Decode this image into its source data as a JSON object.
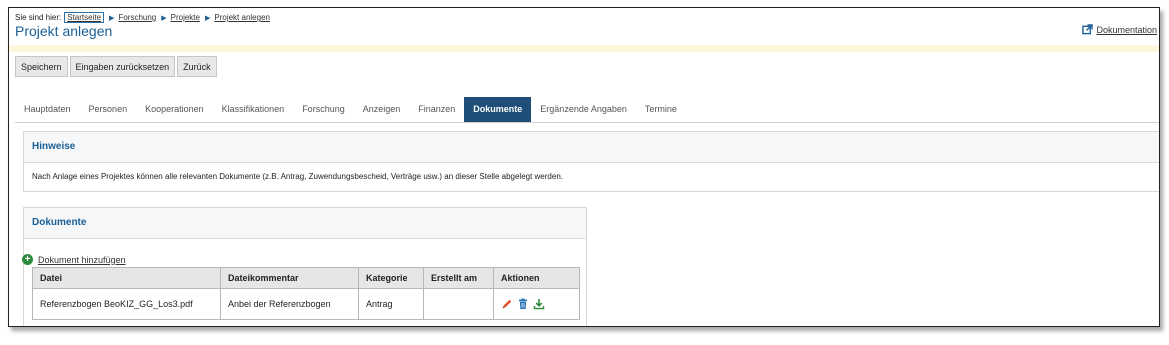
{
  "breadcrumb": {
    "prefix": "Sie sind hier:",
    "items": [
      "Startseite",
      "Forschung",
      "Projekte",
      "Projekt anlegen"
    ]
  },
  "page_title": "Projekt anlegen",
  "documentation_link": "Dokumentation",
  "buttons": {
    "save": "Speichern",
    "reset": "Eingaben zurücksetzen",
    "back": "Zurück"
  },
  "tabs": [
    "Hauptdaten",
    "Personen",
    "Kooperationen",
    "Klassifikationen",
    "Forschung",
    "Anzeigen",
    "Finanzen",
    "Dokumente",
    "Ergänzende Angaben",
    "Termine"
  ],
  "active_tab": "Dokumente",
  "hints": {
    "title": "Hinweise",
    "text": "Nach Anlage eines Projektes können alle relevanten Dokumente (z.B. Antrag, Zuwendungsbescheid, Verträge usw.) an dieser Stelle abgelegt werden."
  },
  "documents": {
    "title": "Dokumente",
    "add_label": "Dokument hinzufügen",
    "columns": [
      "Datei",
      "Dateikommentar",
      "Kategorie",
      "Erstellt am",
      "Aktionen"
    ],
    "rows": [
      {
        "file": "Referenzbogen BeoKIZ_GG_Los3.pdf",
        "comment": "Anbei der Referenzbogen",
        "category": "Antrag",
        "created": "",
        "actions": [
          "edit-icon",
          "delete-icon",
          "download-icon"
        ]
      }
    ]
  },
  "colors": {
    "accent": "#1a5f96",
    "active_tab": "#1f4e79",
    "notice_bar": "#fbf7da",
    "edit_icon": "#e0502a",
    "trash_icon": "#1f6fb2",
    "download_icon": "#2e8b3d",
    "add_icon": "#2e8b3d"
  }
}
